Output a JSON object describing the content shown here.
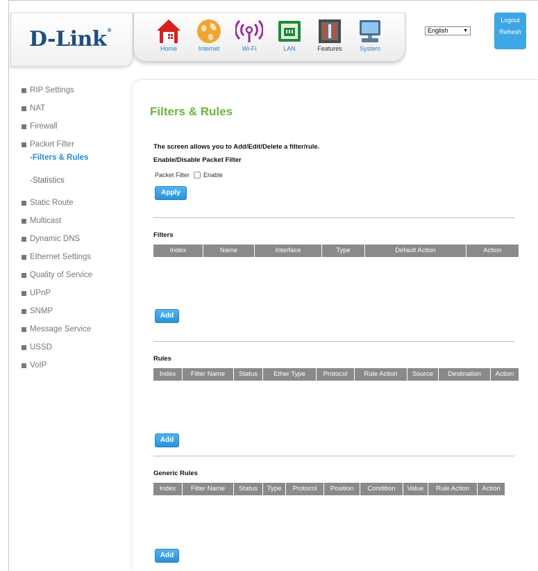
{
  "brand": {
    "logo": "D-Link"
  },
  "nav": [
    {
      "label": "Home",
      "icon": "home-icon"
    },
    {
      "label": "Internet",
      "icon": "globe-icon"
    },
    {
      "label": "Wi-Fi",
      "icon": "wifi-icon"
    },
    {
      "label": "LAN",
      "icon": "lan-icon"
    },
    {
      "label": "Features",
      "icon": "features-icon"
    },
    {
      "label": "System",
      "icon": "system-icon"
    }
  ],
  "language": {
    "selected": "English"
  },
  "session": {
    "logout_label": "Logout",
    "refresh_label": "Refresh"
  },
  "sidebar": {
    "items": [
      {
        "label": "RIP Settings"
      },
      {
        "label": "NAT"
      },
      {
        "label": "Firewall"
      },
      {
        "label": "Packet Filter"
      },
      {
        "label": "Static Route"
      },
      {
        "label": "Multicast"
      },
      {
        "label": "Dynamic DNS"
      },
      {
        "label": "Ethernet Settings"
      },
      {
        "label": "Quality of Service"
      },
      {
        "label": "UPnP"
      },
      {
        "label": "SNMP"
      },
      {
        "label": "Message Service"
      },
      {
        "label": "USSD"
      },
      {
        "label": "VoIP"
      }
    ],
    "sub_items": [
      {
        "label": "-Filters & Rules",
        "active": true
      },
      {
        "label": "-Statistics",
        "active": false
      }
    ]
  },
  "main": {
    "title": "Filters & Rules",
    "description": "The screen allows you to Add/Edit/Delete a filter/rule.",
    "enable_heading": "Enable/Disable Packet Filter",
    "packet_filter_label": "Packet Filter",
    "enable_label": "Enable",
    "enable_checked": false,
    "apply_label": "Apply",
    "filters": {
      "heading": "Filters",
      "columns": [
        "Index",
        "Name",
        "Interface",
        "Type",
        "Default Action",
        "Action"
      ],
      "rows": [],
      "add_label": "Add"
    },
    "rules": {
      "heading": "Rules",
      "columns": [
        "Index",
        "Filter Name",
        "Status",
        "Ether Type",
        "Protocol",
        "Rule Action",
        "Source",
        "Destination",
        "Action"
      ],
      "rows": [],
      "add_label": "Add"
    },
    "generic_rules": {
      "heading": "Generic Rules",
      "columns": [
        "Index",
        "Filter Name",
        "Status",
        "Type",
        "Protocol",
        "Position",
        "Condition",
        "Value",
        "Rule Action",
        "Action"
      ],
      "rows": [],
      "add_label": "Add"
    }
  },
  "colors": {
    "accent": "#3da6e6",
    "title": "#6bb33c",
    "brand": "#1d4f7c",
    "table_header": "#8a8a8a",
    "sidebar_active": "#2a8bd6"
  }
}
